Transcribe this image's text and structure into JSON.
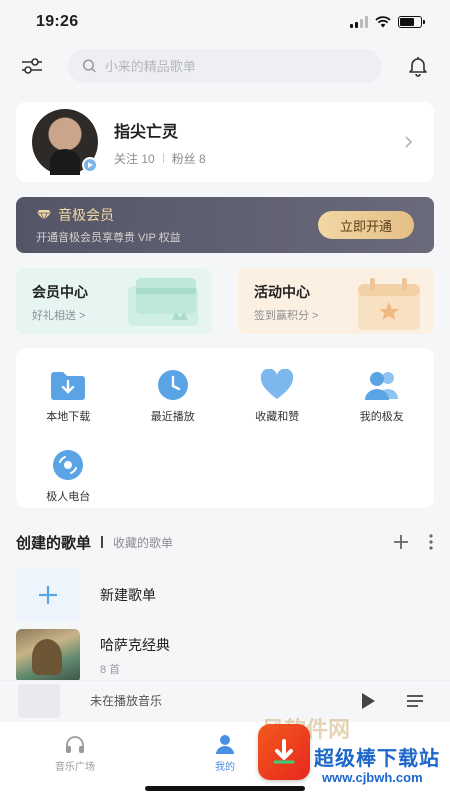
{
  "status": {
    "time": "19:26",
    "battery_level": 0.7
  },
  "search": {
    "placeholder": "小来的精品歌单"
  },
  "profile": {
    "name": "指尖亡灵",
    "follow": "关注 10",
    "fans": "粉丝 8"
  },
  "vip": {
    "title": "音极会员",
    "subtitle": "开通音极会员享尊贵 VIP 权益",
    "button": "立即开通"
  },
  "centers": {
    "member": {
      "title": "会员中心",
      "sub": "好礼相送 >"
    },
    "activity": {
      "title": "活动中心",
      "sub": "签到赢积分 >"
    }
  },
  "quick": [
    {
      "label": "本地下载",
      "icon": "folder-download-icon"
    },
    {
      "label": "最近播放",
      "icon": "clock-icon"
    },
    {
      "label": "收藏和赞",
      "icon": "heart-icon"
    },
    {
      "label": "我的极友",
      "icon": "friends-icon"
    },
    {
      "label": "极人电台",
      "icon": "radio-disc-icon"
    }
  ],
  "playlists": {
    "tab_created": "创建的歌单",
    "tab_collected": "收藏的歌单",
    "new_label": "新建歌单",
    "items": [
      {
        "title": "哈萨克经典",
        "count": "8 首"
      }
    ]
  },
  "player": {
    "text": "未在播放音乐"
  },
  "tabs": [
    {
      "label": "音乐广场"
    },
    {
      "label": "我的"
    }
  ],
  "watermark": {
    "name": "超级棒下载站",
    "url": "www.cjbwh.com",
    "ghost": "风软件网"
  },
  "colors": {
    "accent": "#4a90e2",
    "vip_gold": "#e4bf86"
  }
}
